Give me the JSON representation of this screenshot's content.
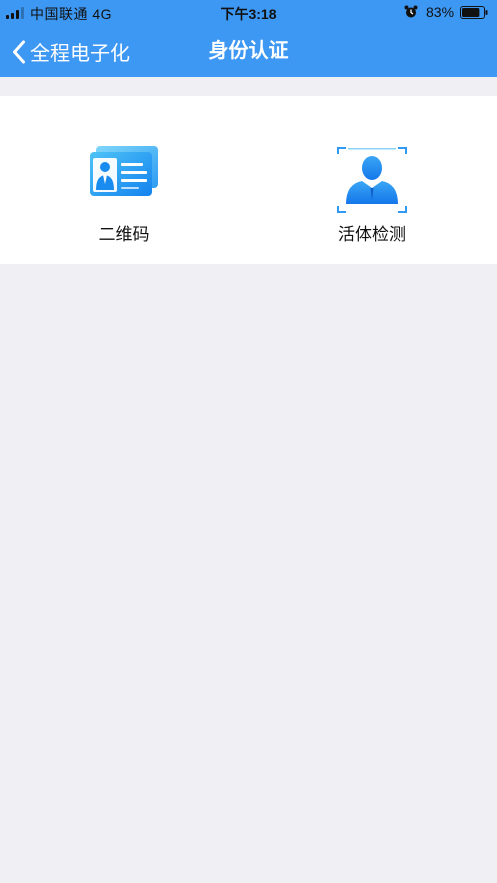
{
  "status_bar": {
    "carrier": "中国联通   4G",
    "time": "下午3:18",
    "battery_percent": "83%",
    "battery_level": 0.83,
    "icons": [
      "signal-icon",
      "alarm-icon",
      "battery-icon"
    ]
  },
  "nav": {
    "back_label": "全程电子化",
    "title": "身份认证",
    "back_icon": "chevron-left-icon"
  },
  "options": [
    {
      "label": "二维码",
      "icon": "id-card-icon"
    },
    {
      "label": "活体检测",
      "icon": "face-scan-icon"
    }
  ],
  "colors": {
    "nav_background": "#3d98f4",
    "page_background": "#efeff4",
    "icon_blue": "#1a8cf0",
    "icon_light_blue": "#55c2f7"
  }
}
